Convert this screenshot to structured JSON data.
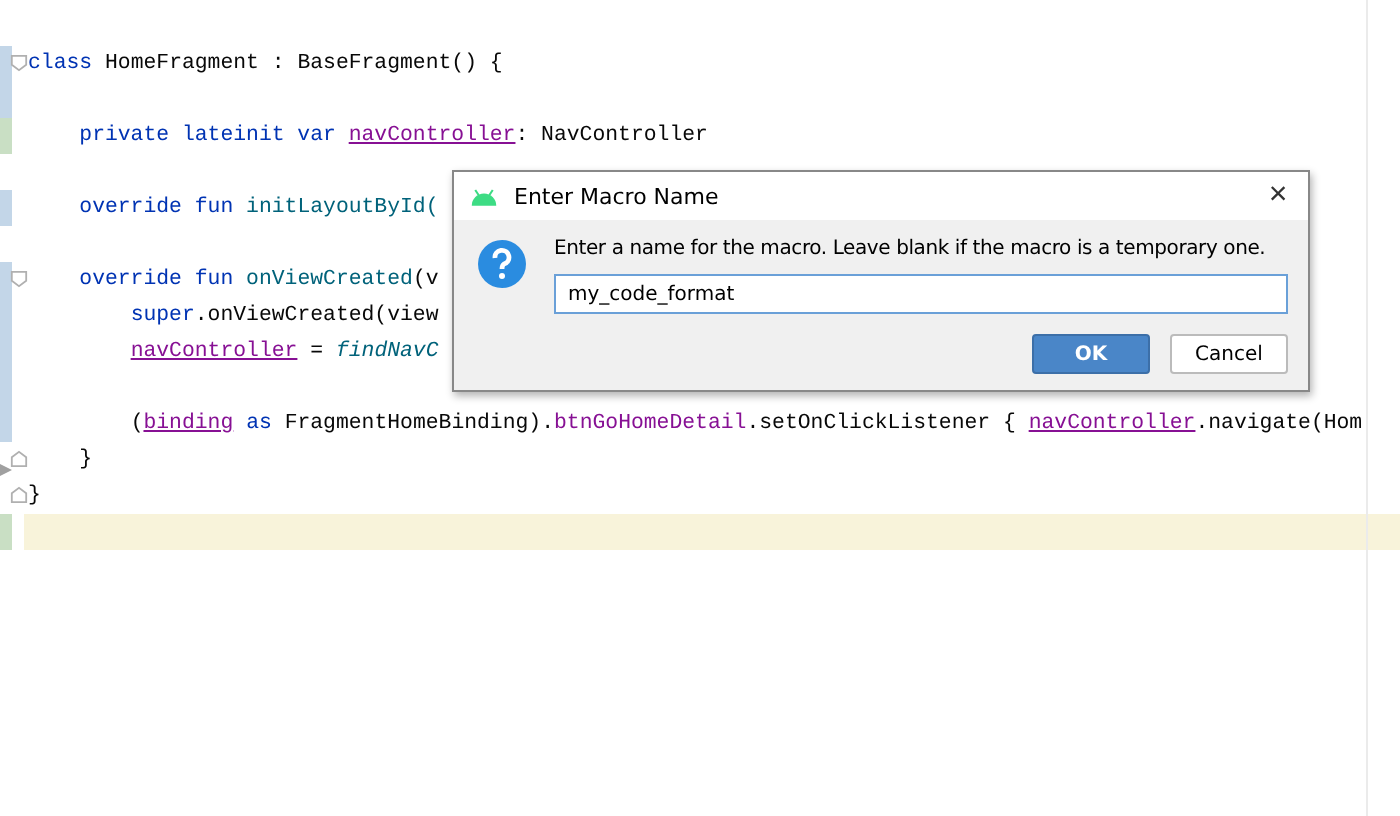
{
  "editor": {
    "lines": [
      {
        "modified": true,
        "added": false,
        "fold_start": true,
        "fold_end": false,
        "marker": false,
        "current": false,
        "tokens": [
          {
            "kind": "kw",
            "text": "class"
          },
          {
            "kind": "plain",
            "text": " HomeFragment : BaseFragment() {"
          }
        ]
      },
      {
        "modified": true,
        "added": false,
        "fold_start": false,
        "fold_end": false,
        "marker": false,
        "current": false
      },
      {
        "modified": false,
        "added": true,
        "fold_start": false,
        "fold_end": false,
        "marker": false,
        "current": false,
        "tokens": [
          {
            "kind": "kw",
            "text": "    private lateinit var "
          },
          {
            "kind": "prop",
            "text": "navController"
          },
          {
            "kind": "plain",
            "text": ": NavController"
          }
        ]
      },
      {
        "modified": false,
        "added": false,
        "fold_start": false,
        "fold_end": false,
        "marker": false,
        "current": false
      },
      {
        "modified": true,
        "added": false,
        "fold_start": false,
        "fold_end": false,
        "marker": false,
        "current": false,
        "tokens": [
          {
            "kind": "kw",
            "text": "    override fun "
          },
          {
            "kind": "fn",
            "text": "initLayoutById("
          }
        ]
      },
      {
        "modified": false,
        "added": false,
        "fold_start": false,
        "fold_end": false,
        "marker": false,
        "current": false
      },
      {
        "modified": true,
        "added": false,
        "fold_start": true,
        "fold_end": false,
        "marker": false,
        "current": false,
        "tokens": [
          {
            "kind": "kw",
            "text": "    override fun "
          },
          {
            "kind": "fn",
            "text": "onViewCreated"
          },
          {
            "kind": "plain",
            "text": "(v"
          }
        ]
      },
      {
        "modified": true,
        "added": false,
        "fold_start": false,
        "fold_end": false,
        "marker": false,
        "current": false,
        "tokens": [
          {
            "kind": "kw",
            "text": "        super"
          },
          {
            "kind": "plain",
            "text": ".onViewCreated(view"
          }
        ]
      },
      {
        "modified": true,
        "added": false,
        "fold_start": false,
        "fold_end": false,
        "marker": false,
        "current": false,
        "tokens": [
          {
            "kind": "prop",
            "text": "        navController"
          },
          {
            "kind": "plain",
            "text": " = "
          },
          {
            "kind": "call",
            "text": "findNavC"
          }
        ]
      },
      {
        "modified": true,
        "added": false,
        "fold_start": false,
        "fold_end": false,
        "marker": false,
        "current": false
      },
      {
        "modified": true,
        "added": false,
        "fold_start": false,
        "fold_end": false,
        "marker": false,
        "current": false,
        "tokens": [
          {
            "kind": "plain",
            "text": "        ("
          },
          {
            "kind": "prop",
            "text": "binding"
          },
          {
            "kind": "kw",
            "text": " as "
          },
          {
            "kind": "plain",
            "text": "FragmentHomeBinding)."
          },
          {
            "kind": "member",
            "text": "btnGoHomeDetail"
          },
          {
            "kind": "plain",
            "text": ".setOnClickListener { "
          },
          {
            "kind": "prop",
            "text": "navController"
          },
          {
            "kind": "plain",
            "text": ".navigate(Hom"
          }
        ]
      },
      {
        "modified": false,
        "added": false,
        "fold_start": false,
        "fold_end": true,
        "marker": false,
        "current": false,
        "tokens": [
          {
            "kind": "plain",
            "text": "    }"
          }
        ]
      },
      {
        "modified": false,
        "added": false,
        "fold_start": false,
        "fold_end": true,
        "marker": true,
        "current": false,
        "tokens": [
          {
            "kind": "plain",
            "text": "}"
          }
        ]
      },
      {
        "modified": false,
        "added": true,
        "fold_start": false,
        "fold_end": false,
        "marker": false,
        "current": true
      }
    ]
  },
  "dialog": {
    "title": "Enter Macro Name",
    "close": "×",
    "message": "Enter a name for the macro. Leave blank if the macro is a temporary one.",
    "name_field": {
      "value": "my_code_format"
    },
    "buttons": [
      {
        "label": "OK",
        "default": true
      },
      {
        "label": "Cancel",
        "default": false
      }
    ]
  }
}
